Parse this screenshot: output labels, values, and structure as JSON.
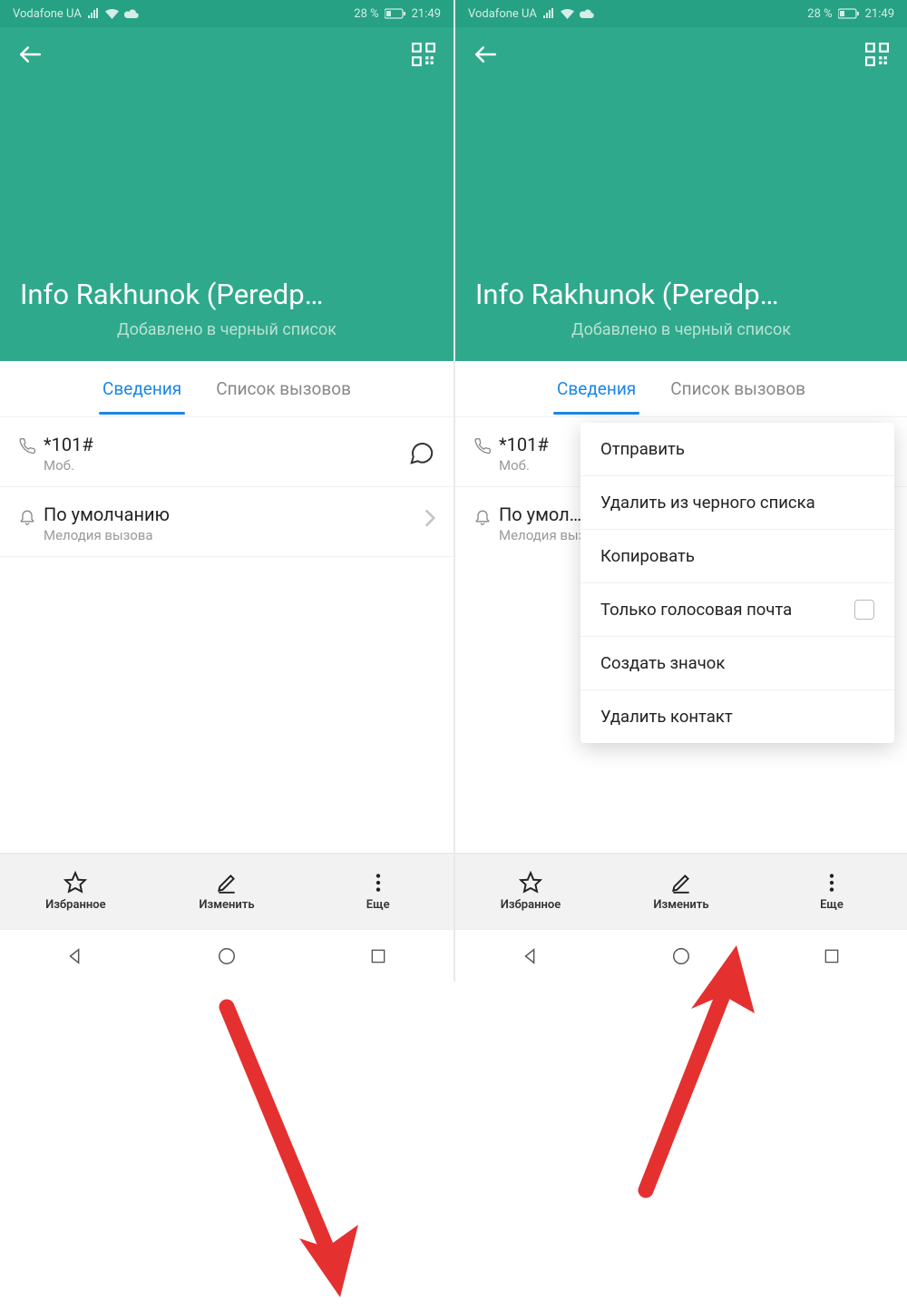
{
  "status": {
    "carrier": "Vodafone UA",
    "battery_pct": "28 %",
    "time": "21:49"
  },
  "header": {
    "contact_name": "Info Rakhunok (Peredp…",
    "subtitle": "Добавлено в черный список"
  },
  "tabs": {
    "details": "Сведения",
    "calls": "Список вызовов"
  },
  "rows": {
    "phone_number": "*101#",
    "phone_type": "Моб.",
    "ringtone_title": "По умолчанию",
    "ringtone_sub": "Мелодия вызова",
    "ringtone_title_truncated": "По умол…"
  },
  "actions": {
    "favorite": "Избранное",
    "edit": "Изменить",
    "more": "Еще"
  },
  "popup": {
    "items": [
      "Отправить",
      "Удалить из черного списка",
      "Копировать",
      "Только голосовая почта",
      "Создать значок",
      "Удалить контакт"
    ]
  },
  "colors": {
    "accent_header": "#2fa98b",
    "accent_tab": "#1b86e6",
    "arrow": "#e53030"
  }
}
